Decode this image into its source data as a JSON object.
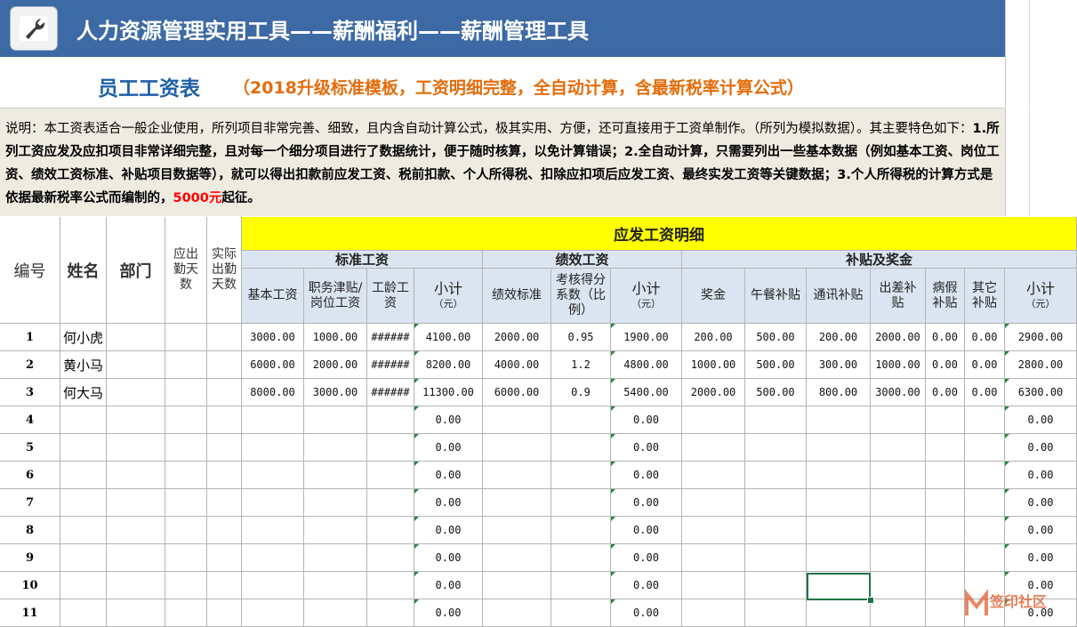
{
  "banner": {
    "title": "人力资源管理实用工具——薪酬福利——薪酬管理工具"
  },
  "heading": {
    "main": "员工工资表",
    "sub": "（2018升级标准模板，工资明细完整，全自动计算，含最新税率计算公式）"
  },
  "description": {
    "p1": "说明：本工资表适合一般企业使用，所列项目非常完善、细致，且内含自动计算公式，极其实用、方便，还可直接用于工资单制作。（所列为模拟数据）。其主要特色如下：",
    "p2": "1.所列工资应发及应扣项目非常详细完整，且对每一个细分项目进行了数据统计，便于随时核算，以免计算错误；2.全自动计算，只需要列出一些基本数据（例如基本工资、岗位工资、绩效工资标准、补贴项目数据等），就可以得出扣款前应发工资、税前扣款、个人所得税、扣除应扣项后应发工资、最终实发工资等关键数据；3.个人所得税的计算方式是依据最新税率公式而编制的，",
    "red": "5000元",
    "p3": "起征。"
  },
  "table": {
    "section_title": "应发工资明细",
    "fixed_headers": {
      "id": "编号",
      "name": "姓名",
      "dept": "部门",
      "due_days": "应出勤天数",
      "actual_days": "实际出勤天数"
    },
    "groups": {
      "standard": "标准工资",
      "performance": "绩效工资",
      "allowance": "补贴及奖金"
    },
    "sub_headers": {
      "base": "基本工资",
      "post": "职务津贴/岗位工资",
      "seniority": "工龄工资",
      "perf_std": "绩效标准",
      "perf_coef": "考核得分系数（比例）",
      "bonus": "奖金",
      "lunch": "午餐补贴",
      "comm": "通讯补贴",
      "travel": "出差补贴",
      "sick": "病假补贴",
      "other": "其它补贴",
      "subtotal": "小计",
      "unit": "（元）"
    },
    "rows": [
      {
        "id": "1",
        "name": "何小虎",
        "base": "3000.00",
        "post": "1000.00",
        "seniority": "######",
        "s1": "4100.00",
        "perf_std": "2000.00",
        "coef": "0.95",
        "s2": "1900.00",
        "bonus": "200.00",
        "lunch": "500.00",
        "comm": "200.00",
        "travel": "2000.00",
        "sick": "0.00",
        "other": "0.00",
        "s3": "2900.00"
      },
      {
        "id": "2",
        "name": "黄小马",
        "base": "6000.00",
        "post": "2000.00",
        "seniority": "######",
        "s1": "8200.00",
        "perf_std": "4000.00",
        "coef": "1.2",
        "s2": "4800.00",
        "bonus": "1000.00",
        "lunch": "500.00",
        "comm": "300.00",
        "travel": "1000.00",
        "sick": "0.00",
        "other": "0.00",
        "s3": "2800.00"
      },
      {
        "id": "3",
        "name": "何大马",
        "base": "8000.00",
        "post": "3000.00",
        "seniority": "######",
        "s1": "11300.00",
        "perf_std": "6000.00",
        "coef": "0.9",
        "s2": "5400.00",
        "bonus": "2000.00",
        "lunch": "500.00",
        "comm": "800.00",
        "travel": "3000.00",
        "sick": "0.00",
        "other": "0.00",
        "s3": "6300.00"
      },
      {
        "id": "4",
        "name": "",
        "base": "",
        "post": "",
        "seniority": "",
        "s1": "0.00",
        "perf_std": "",
        "coef": "",
        "s2": "0.00",
        "bonus": "",
        "lunch": "",
        "comm": "",
        "travel": "",
        "sick": "",
        "other": "",
        "s3": "0.00"
      },
      {
        "id": "5",
        "name": "",
        "base": "",
        "post": "",
        "seniority": "",
        "s1": "0.00",
        "perf_std": "",
        "coef": "",
        "s2": "0.00",
        "bonus": "",
        "lunch": "",
        "comm": "",
        "travel": "",
        "sick": "",
        "other": "",
        "s3": "0.00"
      },
      {
        "id": "6",
        "name": "",
        "base": "",
        "post": "",
        "seniority": "",
        "s1": "0.00",
        "perf_std": "",
        "coef": "",
        "s2": "0.00",
        "bonus": "",
        "lunch": "",
        "comm": "",
        "travel": "",
        "sick": "",
        "other": "",
        "s3": "0.00"
      },
      {
        "id": "7",
        "name": "",
        "base": "",
        "post": "",
        "seniority": "",
        "s1": "0.00",
        "perf_std": "",
        "coef": "",
        "s2": "0.00",
        "bonus": "",
        "lunch": "",
        "comm": "",
        "travel": "",
        "sick": "",
        "other": "",
        "s3": "0.00"
      },
      {
        "id": "8",
        "name": "",
        "base": "",
        "post": "",
        "seniority": "",
        "s1": "0.00",
        "perf_std": "",
        "coef": "",
        "s2": "0.00",
        "bonus": "",
        "lunch": "",
        "comm": "",
        "travel": "",
        "sick": "",
        "other": "",
        "s3": "0.00"
      },
      {
        "id": "9",
        "name": "",
        "base": "",
        "post": "",
        "seniority": "",
        "s1": "0.00",
        "perf_std": "",
        "coef": "",
        "s2": "0.00",
        "bonus": "",
        "lunch": "",
        "comm": "",
        "travel": "",
        "sick": "",
        "other": "",
        "s3": "0.00"
      },
      {
        "id": "10",
        "name": "",
        "base": "",
        "post": "",
        "seniority": "",
        "s1": "0.00",
        "perf_std": "",
        "coef": "",
        "s2": "0.00",
        "bonus": "",
        "lunch": "",
        "comm": "",
        "travel": "",
        "sick": "",
        "other": "",
        "s3": "0.00"
      },
      {
        "id": "11",
        "name": "",
        "base": "",
        "post": "",
        "seniority": "",
        "s1": "0.00",
        "perf_std": "",
        "coef": "",
        "s2": "0.00",
        "bonus": "",
        "lunch": "",
        "comm": "",
        "travel": "",
        "sick": "",
        "other": "",
        "s3": "0.00"
      }
    ]
  },
  "watermark": {
    "text": "签印社区"
  },
  "colors": {
    "banner": "#3d6aa4",
    "title_blue": "#1f5fa8",
    "title_orange": "#e46c0a",
    "section_yellow": "#ffff00",
    "header_blue": "#dbe5f1",
    "desc_bg": "#eeece1"
  }
}
